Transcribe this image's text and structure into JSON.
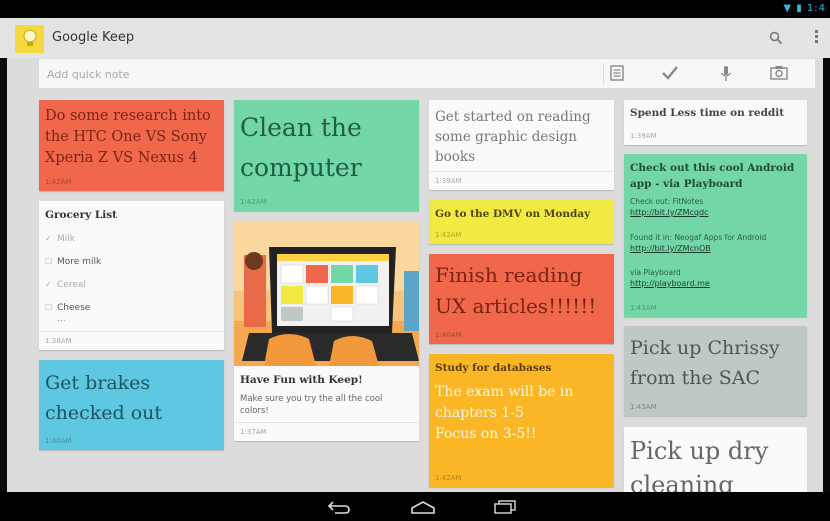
{
  "app": {
    "title": "Google Keep"
  },
  "quick_note": {
    "placeholder": "Add quick note",
    "icons": [
      "text-note-icon",
      "checklist-icon",
      "microphone-icon",
      "camera-icon"
    ]
  },
  "colors": {
    "red": "#f0674b",
    "teal": "#72d6a7",
    "yellow": "#f3ea41",
    "orange": "#fbb626",
    "blue": "#5ec7e1",
    "gray": "#c0c8c6",
    "white": "#fafafa",
    "accent": "#33b5e5"
  },
  "notes": {
    "htc": {
      "text": "Do some research into the HTC One VS Sony Xperia Z VS Nexus 4",
      "time": "1:42AM",
      "color": "red"
    },
    "grocery": {
      "title": "Grocery List",
      "items": [
        {
          "text": "Milk",
          "checked": true
        },
        {
          "text": "More milk",
          "checked": false
        },
        {
          "text": "Cereal",
          "checked": true
        },
        {
          "text": "Cheese",
          "checked": false
        }
      ],
      "more": "...",
      "time": "1:38AM"
    },
    "brakes": {
      "text": "Get brakes checked out",
      "time": "1:40AM",
      "color": "blue"
    },
    "clean": {
      "text": "Clean the computer",
      "time": "1:42AM",
      "color": "teal"
    },
    "fun": {
      "title": "Have Fun with Keep!",
      "body": "Make sure you try the all the cool colors!",
      "time": "1:37AM"
    },
    "graphic": {
      "text": "Get started on reading some graphic design books",
      "time": "1:39AM"
    },
    "dmv": {
      "title": "Go to the DMV on Monday",
      "time": "1:42AM",
      "color": "yellow"
    },
    "ux": {
      "text": "Finish reading UX articles!!!!!!",
      "time": "1:40AM",
      "color": "red"
    },
    "study": {
      "title": "Study for databases",
      "body1": "The exam will be in chapters 1-5",
      "body2": "Focus on 3-5!!",
      "time": "1:42AM",
      "color": "orange"
    },
    "reddit": {
      "title": "Spend Less time on reddit",
      "time": "1:39AM"
    },
    "android": {
      "title": "Check out this cool Android app - via Playboard",
      "l1": "Check out: FitNotes",
      "link1": "http://bit.ly/ZMcqdc",
      "l2": "Found it in: Neogaf Apps for Android",
      "link2": "http://bit.ly/ZMcnOB",
      "l3": "via Playboard",
      "link3": "http://playboard.me",
      "time": "1:43AM",
      "color": "teal"
    },
    "chrissy": {
      "text": "Pick up Chrissy from the SAC",
      "time": "1:43AM",
      "color": "gray"
    },
    "dry": {
      "text": "Pick up dry cleaning"
    }
  }
}
